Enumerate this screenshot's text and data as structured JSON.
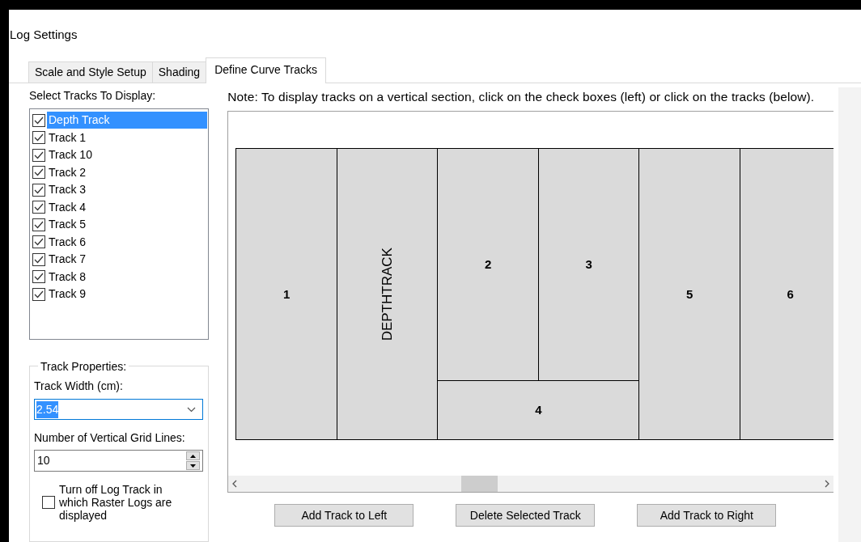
{
  "window": {
    "title": "Log Settings"
  },
  "tabs": [
    {
      "label": "Scale and Style Setup",
      "selected": false
    },
    {
      "label": "Shading",
      "selected": false
    },
    {
      "label": "Define Curve Tracks",
      "selected": true
    }
  ],
  "track_list": {
    "label": "Select Tracks To Display:",
    "items": [
      {
        "label": "Depth Track",
        "checked": true,
        "selected": true
      },
      {
        "label": "Track 1",
        "checked": true,
        "selected": false
      },
      {
        "label": "Track 10",
        "checked": true,
        "selected": false
      },
      {
        "label": "Track 2",
        "checked": true,
        "selected": false
      },
      {
        "label": "Track 3",
        "checked": true,
        "selected": false
      },
      {
        "label": "Track 4",
        "checked": true,
        "selected": false
      },
      {
        "label": "Track 5",
        "checked": true,
        "selected": false
      },
      {
        "label": "Track 6",
        "checked": true,
        "selected": false
      },
      {
        "label": "Track 7",
        "checked": true,
        "selected": false
      },
      {
        "label": "Track 8",
        "checked": true,
        "selected": false
      },
      {
        "label": "Track 9",
        "checked": true,
        "selected": false
      }
    ]
  },
  "track_properties": {
    "title": "Track Properties:",
    "width_label": "Track Width (cm):",
    "width_value": "2.54",
    "grid_label": "Number of Vertical Grid Lines:",
    "grid_value": "10",
    "raster_option": {
      "label": "Turn off Log Track in which Raster Logs are displayed",
      "checked": false
    }
  },
  "note": "Note: To display tracks on a vertical section, click on the check boxes (left) or click on the tracks (below).",
  "track_layout": [
    {
      "rows": [
        [
          {
            "label": "1",
            "kind": "horizontal"
          }
        ]
      ]
    },
    {
      "rows": [
        [
          {
            "label": "DEPTHTRACK",
            "kind": "vertical"
          }
        ]
      ]
    },
    {
      "rows": [
        [
          {
            "label": "2",
            "kind": "horizontal"
          },
          {
            "label": "3",
            "kind": "horizontal"
          }
        ],
        [
          {
            "label": "4",
            "kind": "horizontal"
          }
        ]
      ]
    },
    {
      "rows": [
        [
          {
            "label": "5",
            "kind": "horizontal"
          }
        ]
      ]
    },
    {
      "rows": [
        [
          {
            "label": "6",
            "kind": "horizontal"
          }
        ]
      ]
    }
  ],
  "buttons": [
    "Add Track to Left",
    "Delete Selected Track",
    "Add Track to Right"
  ]
}
